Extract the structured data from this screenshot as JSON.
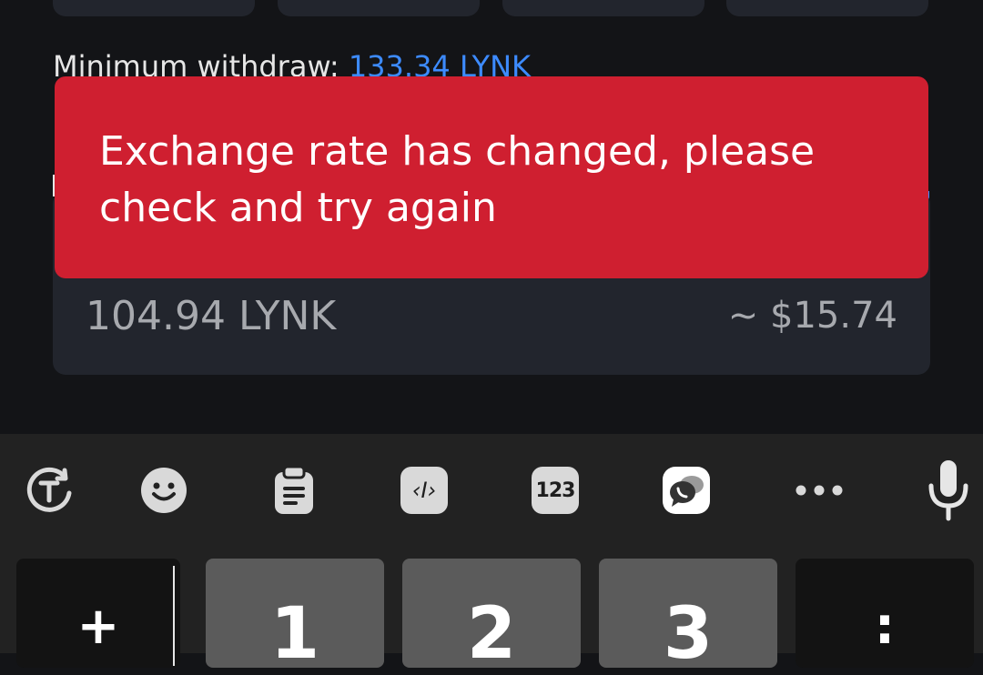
{
  "withdraw": {
    "minimum_label": "Minimum withdraw:",
    "minimum_value": "133.34 LYNK",
    "amount": "104.94 LYNK",
    "fiat_estimate": "~ $15.74"
  },
  "toast": {
    "message": "Exchange rate has changed, please check and try again"
  },
  "keyboard": {
    "toolbar": [
      {
        "name": "translate-icon"
      },
      {
        "name": "emoji-icon"
      },
      {
        "name": "clipboard-icon"
      },
      {
        "name": "text-edit-icon"
      },
      {
        "name": "number-pad-icon",
        "label": "123"
      },
      {
        "name": "chat-icon"
      },
      {
        "name": "more-icon"
      },
      {
        "name": "microphone-icon"
      }
    ],
    "keys": {
      "plus": "+",
      "one": "1",
      "two": "2",
      "three": "3",
      "colon": ":"
    }
  },
  "colors": {
    "toast_bg": "#cf1f30",
    "link": "#3d8bff",
    "card_bg": "#22252d"
  }
}
